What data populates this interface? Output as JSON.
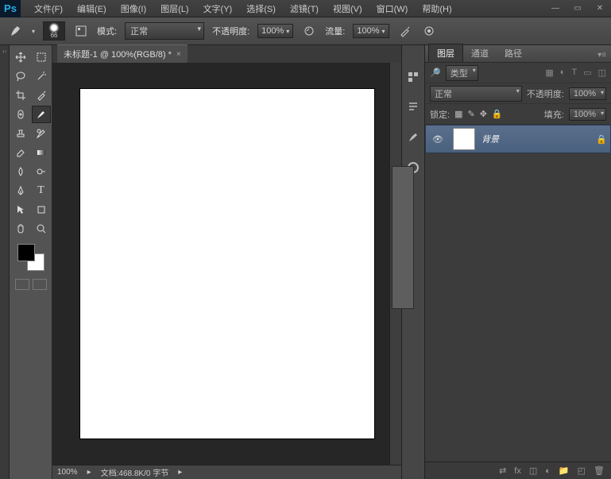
{
  "menus": [
    "文件(F)",
    "编辑(E)",
    "图像(I)",
    "图层(L)",
    "文字(Y)",
    "选择(S)",
    "滤镜(T)",
    "视图(V)",
    "窗口(W)",
    "帮助(H)"
  ],
  "options": {
    "brush_size": "66",
    "mode_label": "模式:",
    "mode_value": "正常",
    "opacity_label": "不透明度:",
    "opacity_value": "100%",
    "flow_label": "流量:",
    "flow_value": "100%"
  },
  "document": {
    "tab_title": "未标题-1 @ 100%(RGB/8) *",
    "zoom": "100%",
    "status": "文档:468.8K/0 字节"
  },
  "panels": {
    "tabs": [
      "图层",
      "通道",
      "路径"
    ],
    "type_label": "类型",
    "blend_mode": "正常",
    "opacity_label": "不透明度:",
    "opacity_value": "100%",
    "lock_label": "锁定:",
    "fill_label": "填充:",
    "fill_value": "100%",
    "layer_name": "背景"
  }
}
